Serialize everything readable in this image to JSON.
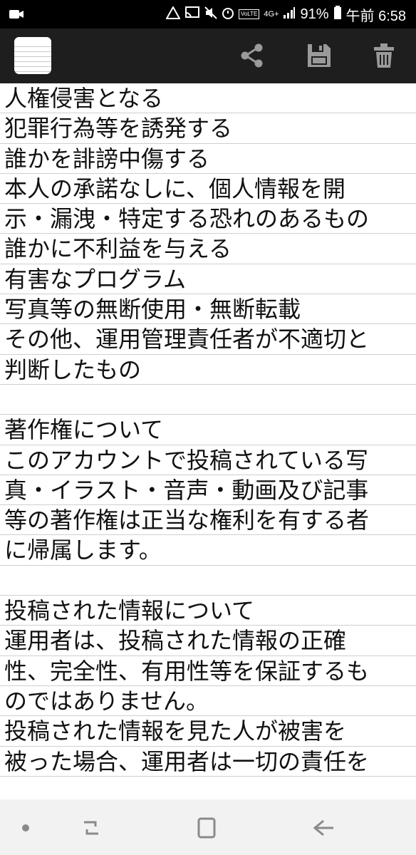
{
  "statusbar": {
    "battery": "91%",
    "time": "午前 6:58",
    "network": "4G+",
    "volte": "VoLTE"
  },
  "toolbar": {
    "actions": [
      "share-icon",
      "save-icon",
      "delete-icon"
    ]
  },
  "note": {
    "lines": [
      "人権侵害となる",
      "犯罪行為等を誘発する",
      "誰かを誹謗中傷する",
      "本人の承諾なしに、個人情報を開",
      "示・漏洩・特定する恐れのあるもの",
      "誰かに不利益を与える",
      "有害なプログラム",
      "写真等の無断使用・無断転載",
      "その他、運用管理責任者が不適切と",
      "判断したもの",
      "",
      "著作権について",
      "このアカウントで投稿されている写",
      "真・イラスト・音声・動画及び記事",
      "等の著作権は正当な権利を有する者",
      "に帰属します。",
      "",
      "投稿された情報について",
      "運用者は、投稿された情報の正確",
      "性、完全性、有用性等を保証するも",
      "のではありません。",
      "投稿された情報を見た人が被害を",
      "被った場合、運用者は一切の責任を",
      ""
    ]
  },
  "navbar": {
    "buttons": [
      "home-dot-icon",
      "recents-icon",
      "overview-icon",
      "back-icon"
    ]
  }
}
